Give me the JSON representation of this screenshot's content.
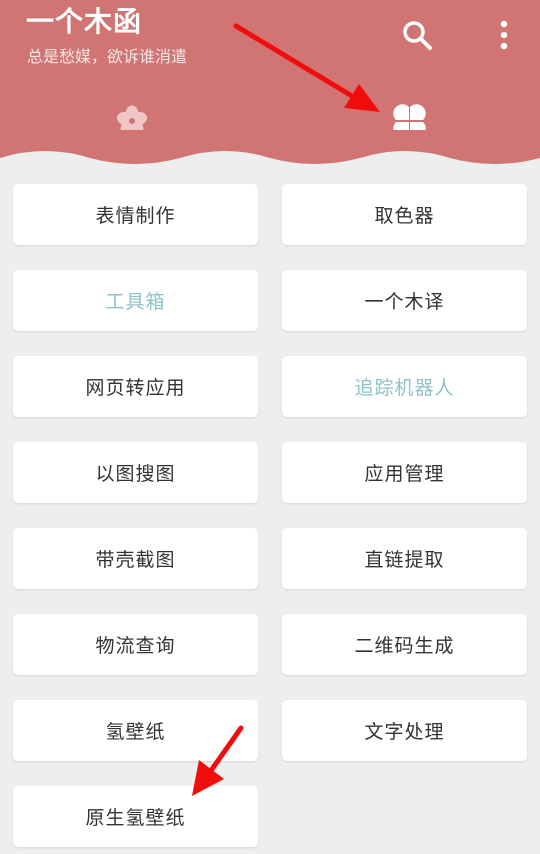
{
  "header": {
    "title": "一个木函",
    "subtitle": "总是愁媒，欲诉谁消遣",
    "background_color": "#d07474",
    "icons": [
      "search-icon",
      "more-vert-icon"
    ]
  },
  "tabs": [
    {
      "icon": "flower-icon",
      "selected": false
    },
    {
      "icon": "four-petal-icon",
      "selected": true
    }
  ],
  "buttons": [
    {
      "label": "表情制作",
      "enabled": true
    },
    {
      "label": "取色器",
      "enabled": true
    },
    {
      "label": "工具箱",
      "enabled": false
    },
    {
      "label": "一个木译",
      "enabled": true
    },
    {
      "label": "网页转应用",
      "enabled": true
    },
    {
      "label": "追踪机器人",
      "enabled": false
    },
    {
      "label": "以图搜图",
      "enabled": true
    },
    {
      "label": "应用管理",
      "enabled": true
    },
    {
      "label": "带壳截图",
      "enabled": true
    },
    {
      "label": "直链提取",
      "enabled": true
    },
    {
      "label": "物流查询",
      "enabled": true
    },
    {
      "label": "二维码生成",
      "enabled": true
    },
    {
      "label": "氢壁纸",
      "enabled": true
    },
    {
      "label": "文字处理",
      "enabled": true
    },
    {
      "label": "原生氢壁纸",
      "enabled": true
    }
  ],
  "colors": {
    "accent": "#d07474",
    "muted_text": "#8fc3c7",
    "annotation_red": "#f20d0d"
  }
}
